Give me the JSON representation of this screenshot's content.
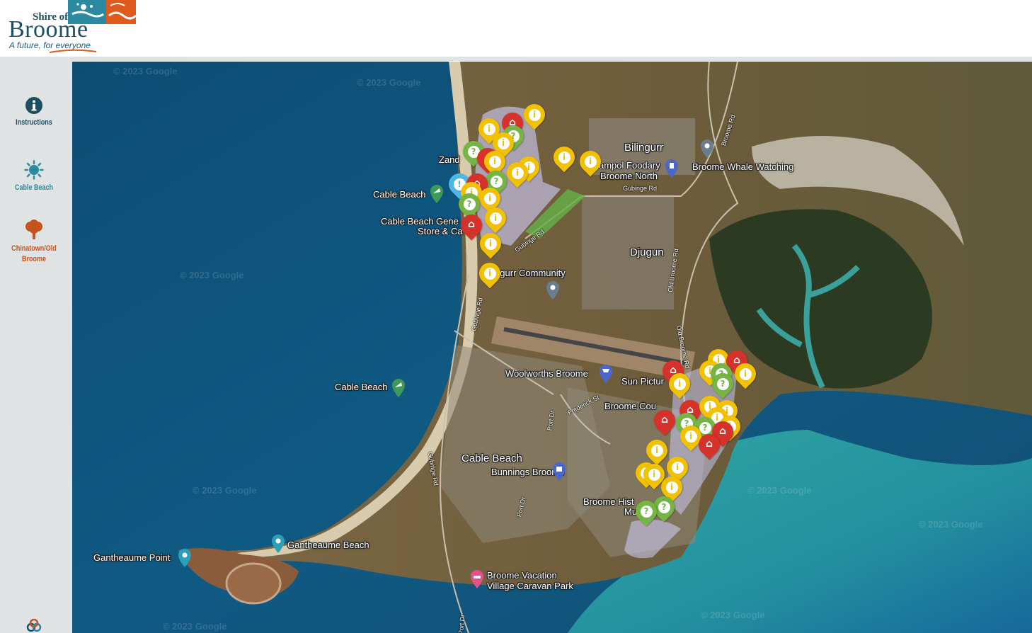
{
  "header": {
    "logo": {
      "shire_of": "Shire of",
      "name": "Broome",
      "tagline": "A future, for everyone",
      "colors": {
        "navy": "#1d4f63",
        "teal": "#2a8aa0",
        "orange": "#e05a1e"
      }
    }
  },
  "sidebar": {
    "items": [
      {
        "label": "Instructions",
        "icon": "info-circle-icon",
        "color": "#1d4f63"
      },
      {
        "label": "Cable Beach",
        "icon": "sun-icon",
        "color": "#2a8aa0"
      },
      {
        "label": "Chinatown/Old Broome",
        "icon": "tree-icon",
        "color": "#c4521c"
      }
    ],
    "bottom_icon": "layers-icon"
  },
  "map": {
    "watermark": "© 2023 Google",
    "places": [
      {
        "name": "Bilingurr"
      },
      {
        "name": "Campol Foodary Broome North",
        "line1": "ampol Foodary",
        "line2": "Broome North"
      },
      {
        "name": "Broome Whale Watching"
      },
      {
        "name": "Zanders",
        "text": "Zand"
      },
      {
        "name": "Cable Beach"
      },
      {
        "name": "Cable Beach General Store & Cafe",
        "line1": "Cable Beach Gene",
        "line2": "Store & Ca"
      },
      {
        "name": "Djugun"
      },
      {
        "name": "Bilingurr Community",
        "text": "B    gurr Community"
      },
      {
        "name": "Woolworths Broome"
      },
      {
        "name": "Sun Pictures",
        "text": "Sun Pictur"
      },
      {
        "name": "Broome Courthouse",
        "text": "Broome Cou"
      },
      {
        "name": "Cable Beach (suburb)",
        "text": "Cable Beach"
      },
      {
        "name": "Cable Beach (beach)",
        "text": "Cable Beach"
      },
      {
        "name": "Bunnings Broome"
      },
      {
        "name": "Broome Historical Museum",
        "line1": "Broome Hist",
        "line2": "Mu"
      },
      {
        "name": "Gantheaume Beach"
      },
      {
        "name": "Gantheaume Point"
      },
      {
        "name": "Broome Vacation Village Caravan Park",
        "line1": "Broome Vacation",
        "line2": "Village Caravan Park"
      }
    ],
    "roads": [
      "Gubinge Rd",
      "Broome Rd",
      "Old Broome Rd",
      "Frederick St",
      "Port Dr"
    ],
    "marker_colors": {
      "info": "#f2c200",
      "question": "#74b543",
      "home": "#d4322a",
      "alert": "#4db8e8"
    }
  }
}
